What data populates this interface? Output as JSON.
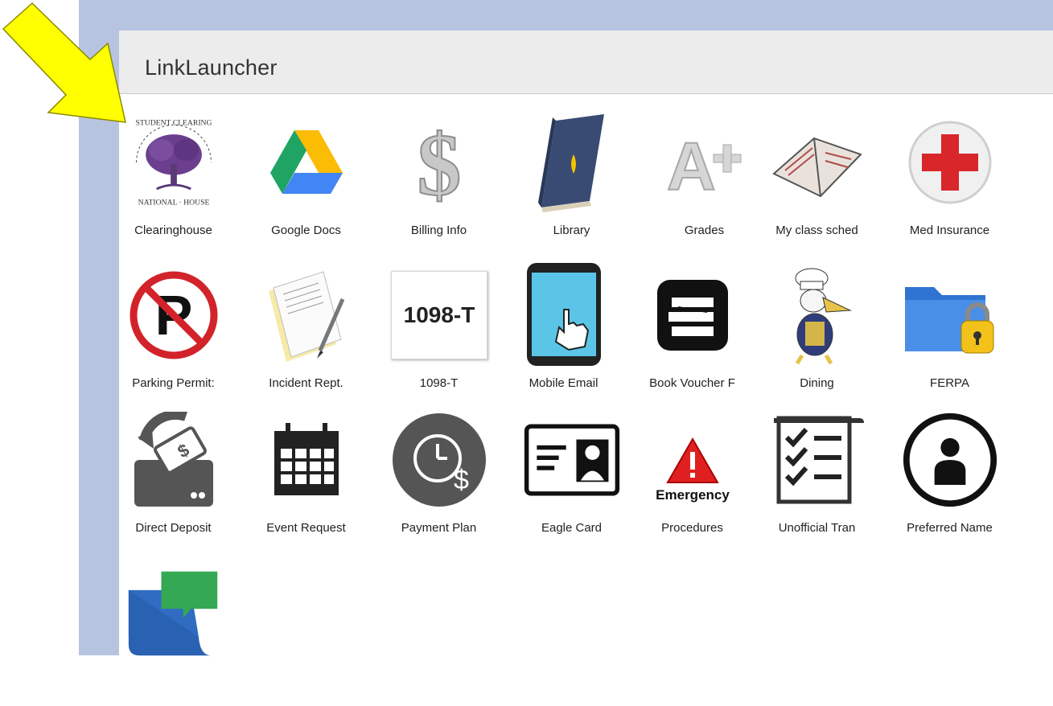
{
  "app": {
    "title": "LinkLauncher"
  },
  "tiles": [
    {
      "label": "Clearinghouse",
      "icon": "clearinghouse-seal-icon"
    },
    {
      "label": "Google Docs",
      "icon": "google-drive-icon"
    },
    {
      "label": "Billing Info",
      "icon": "dollar-sign-icon"
    },
    {
      "label": "Library",
      "icon": "book-icon"
    },
    {
      "label": "Grades",
      "icon": "a-plus-icon"
    },
    {
      "label": "My class sched",
      "icon": "open-book-icon"
    },
    {
      "label": "Med Insurance",
      "icon": "red-cross-icon"
    },
    {
      "label": "Parking Permit:",
      "icon": "no-parking-icon"
    },
    {
      "label": "Incident Rept.",
      "icon": "document-pen-icon"
    },
    {
      "label": "1098-T",
      "icon": "tax-form-icon",
      "icon_text": "1098-T"
    },
    {
      "label": "Mobile Email",
      "icon": "smartphone-icon"
    },
    {
      "label": "Book Voucher F",
      "icon": "books-icon"
    },
    {
      "label": "Dining",
      "icon": "pelican-chef-icon"
    },
    {
      "label": "FERPA",
      "icon": "locked-folder-icon"
    },
    {
      "label": "Direct Deposit",
      "icon": "deposit-icon"
    },
    {
      "label": "Event Request",
      "icon": "calendar-icon"
    },
    {
      "label": "Payment Plan",
      "icon": "clock-dollar-icon"
    },
    {
      "label": "Eagle Card",
      "icon": "id-card-icon"
    },
    {
      "label": "Procedures",
      "icon": "warning-icon",
      "icon_text": "Emergency"
    },
    {
      "label": "Unofficial Tran",
      "icon": "checklist-icon"
    },
    {
      "label": "Preferred Name",
      "icon": "person-circle-icon"
    },
    {
      "label": "",
      "icon": "chat-folder-icon"
    }
  ],
  "colors": {
    "frame": "#b7c4e0",
    "header_bg": "#ececec",
    "arrow": "#ffff00"
  }
}
